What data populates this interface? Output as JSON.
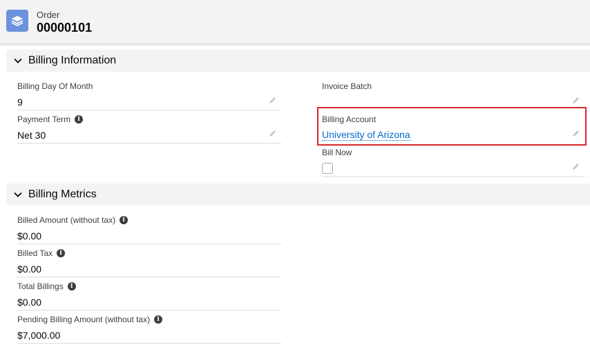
{
  "header": {
    "object_type": "Order",
    "record_number": "00000101",
    "icon": "layers-icon"
  },
  "sections": {
    "billing_information": {
      "title": "Billing Information",
      "fields": {
        "billing_day_of_month": {
          "label": "Billing Day Of Month",
          "value": "9"
        },
        "payment_term": {
          "label": "Payment Term",
          "value": "Net 30"
        },
        "invoice_batch": {
          "label": "Invoice Batch",
          "value": ""
        },
        "billing_account": {
          "label": "Billing Account",
          "value": "University of Arizona"
        },
        "bill_now": {
          "label": "Bill Now",
          "checked": false
        }
      }
    },
    "billing_metrics": {
      "title": "Billing Metrics",
      "fields": {
        "billed_amount": {
          "label": "Billed Amount (without tax)",
          "value": "$0.00"
        },
        "billed_tax": {
          "label": "Billed Tax",
          "value": "$0.00"
        },
        "total_billings": {
          "label": "Total Billings",
          "value": "$0.00"
        },
        "pending_billing_amount": {
          "label": "Pending Billing Amount (without tax)",
          "value": "$7,000.00"
        }
      }
    }
  },
  "colors": {
    "link": "#006dcc",
    "highlight": "#d9242a",
    "header_bg": "#f3f3f3",
    "icon_bg": "#6b92dc"
  }
}
